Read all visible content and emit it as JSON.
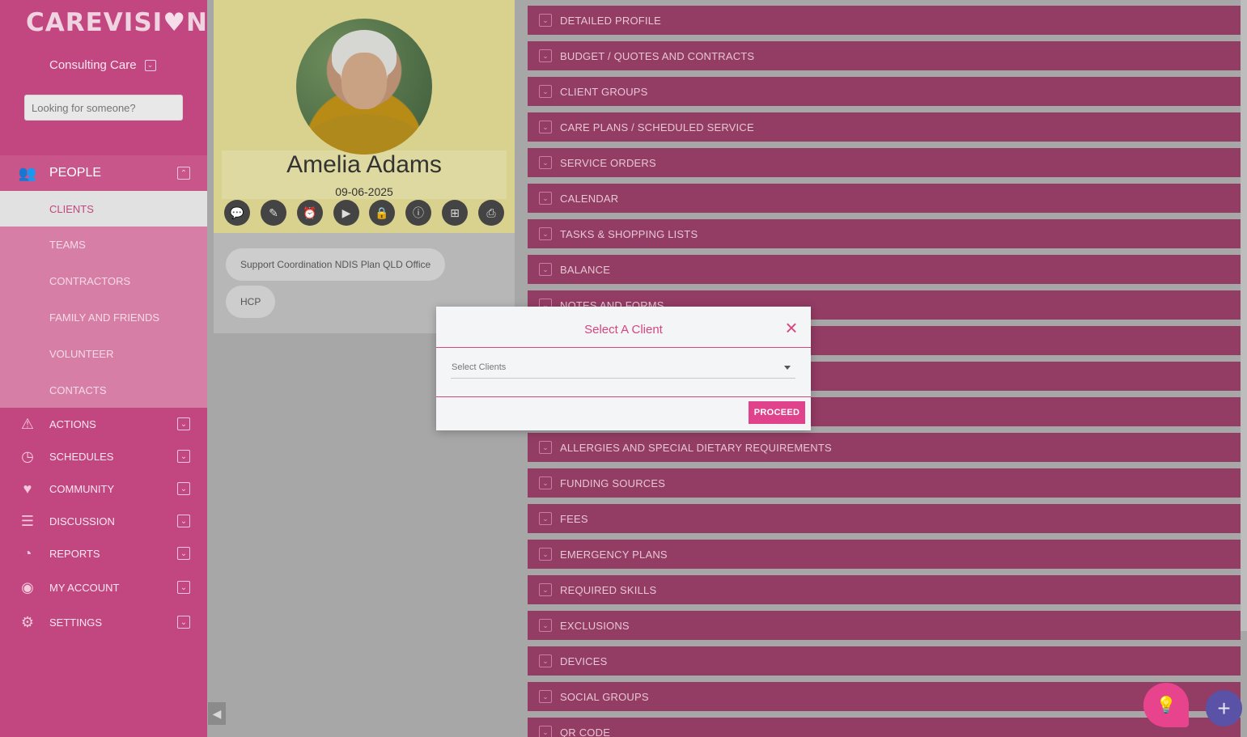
{
  "brand": {
    "logo_text": "CAREVISI",
    "logo_heart": "♥",
    "logo_end": "N"
  },
  "org": {
    "name": "Consulting Care",
    "toggle_icon": "checkbox-chevron-icon"
  },
  "search": {
    "placeholder": "Looking for someone?"
  },
  "sidebar": {
    "people": {
      "label": "PEOPLE",
      "icon": "people-icon"
    },
    "sub_items": [
      {
        "label": "CLIENTS",
        "active": true
      },
      {
        "label": "TEAMS"
      },
      {
        "label": "CONTRACTORS"
      },
      {
        "label": "FAMILY AND FRIENDS"
      },
      {
        "label": "VOLUNTEER"
      },
      {
        "label": "CONTACTS"
      }
    ],
    "items": [
      {
        "label": "ACTIONS",
        "icon": "warning-icon"
      },
      {
        "label": "SCHEDULES",
        "icon": "clock-icon"
      },
      {
        "label": "COMMUNITY",
        "icon": "heart-icon"
      },
      {
        "label": "DISCUSSION",
        "icon": "chat-icon"
      },
      {
        "label": "REPORTS",
        "icon": "reports-icon"
      },
      {
        "label": "MY ACCOUNT",
        "icon": "user-icon"
      },
      {
        "label": "SETTINGS",
        "icon": "gear-icon"
      }
    ]
  },
  "profile": {
    "name": "Amelia Adams",
    "dob": "09-06-2025",
    "actions": [
      "message-icon",
      "edit-icon",
      "alarm-icon",
      "video-icon",
      "lock-icon",
      "info-icon",
      "add-icon",
      "print-icon"
    ],
    "tags": [
      "Support Coordination NDIS Plan QLD Office",
      "HCP"
    ]
  },
  "sections": [
    "DETAILED PROFILE",
    "BUDGET / QUOTES AND CONTRACTS",
    "CLIENT GROUPS",
    "CARE PLANS / SCHEDULED SERVICE",
    "SERVICE ORDERS",
    "CALENDAR",
    "TASKS & SHOPPING LISTS",
    "BALANCE",
    "NOTES AND FORMS",
    "",
    "",
    "",
    "ALLERGIES AND SPECIAL DIETARY REQUIREMENTS",
    "FUNDING SOURCES",
    "FEES",
    "EMERGENCY PLANS",
    "REQUIRED SKILLS",
    "EXCLUSIONS",
    "DEVICES",
    "SOCIAL GROUPS",
    "QR CODE"
  ],
  "modal": {
    "title": "Select A Client",
    "select_placeholder": "Select Clients",
    "proceed_label": "PROCEED"
  },
  "colors": {
    "sidebar": "#c2467f",
    "accordion": "#933c64",
    "accent": "#e0428c",
    "fab_secondary": "#5a52a6"
  }
}
